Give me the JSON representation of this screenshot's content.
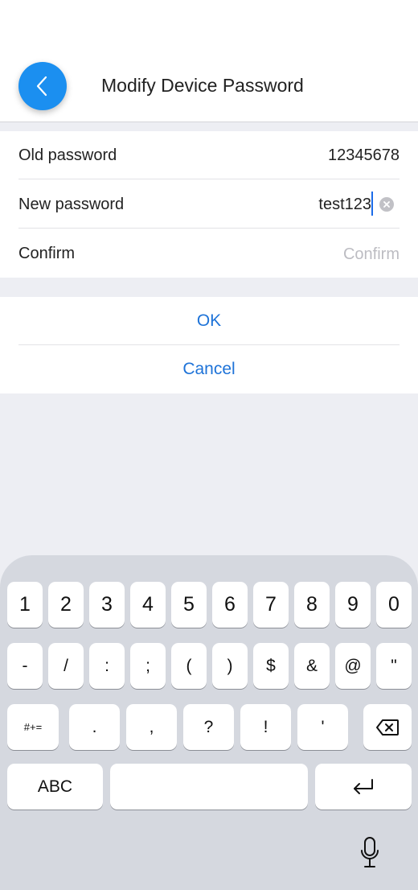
{
  "header": {
    "title": "Modify Device Password",
    "back_icon": "chevron-left-icon",
    "accent_color": "#1b8ff0"
  },
  "form": {
    "old_password": {
      "label": "Old password",
      "value": "12345678"
    },
    "new_password": {
      "label": "New password",
      "value": "test123"
    },
    "confirm": {
      "label": "Confirm",
      "value": "",
      "placeholder": "Confirm"
    }
  },
  "actions": {
    "ok_label": "OK",
    "cancel_label": "Cancel",
    "link_color": "#1e73d8"
  },
  "keyboard": {
    "row1": [
      "1",
      "2",
      "3",
      "4",
      "5",
      "6",
      "7",
      "8",
      "9",
      "0"
    ],
    "row2": [
      "-",
      "/",
      ":",
      ";",
      "(",
      ")",
      "$",
      "&",
      "@",
      "\""
    ],
    "row3": [
      "#+=",
      ".",
      ",",
      "?",
      "!",
      "'"
    ],
    "row4": [
      "ABC",
      ""
    ],
    "delete_icon": "backspace-icon",
    "return_icon": "return-icon",
    "mic_icon": "microphone-icon"
  }
}
